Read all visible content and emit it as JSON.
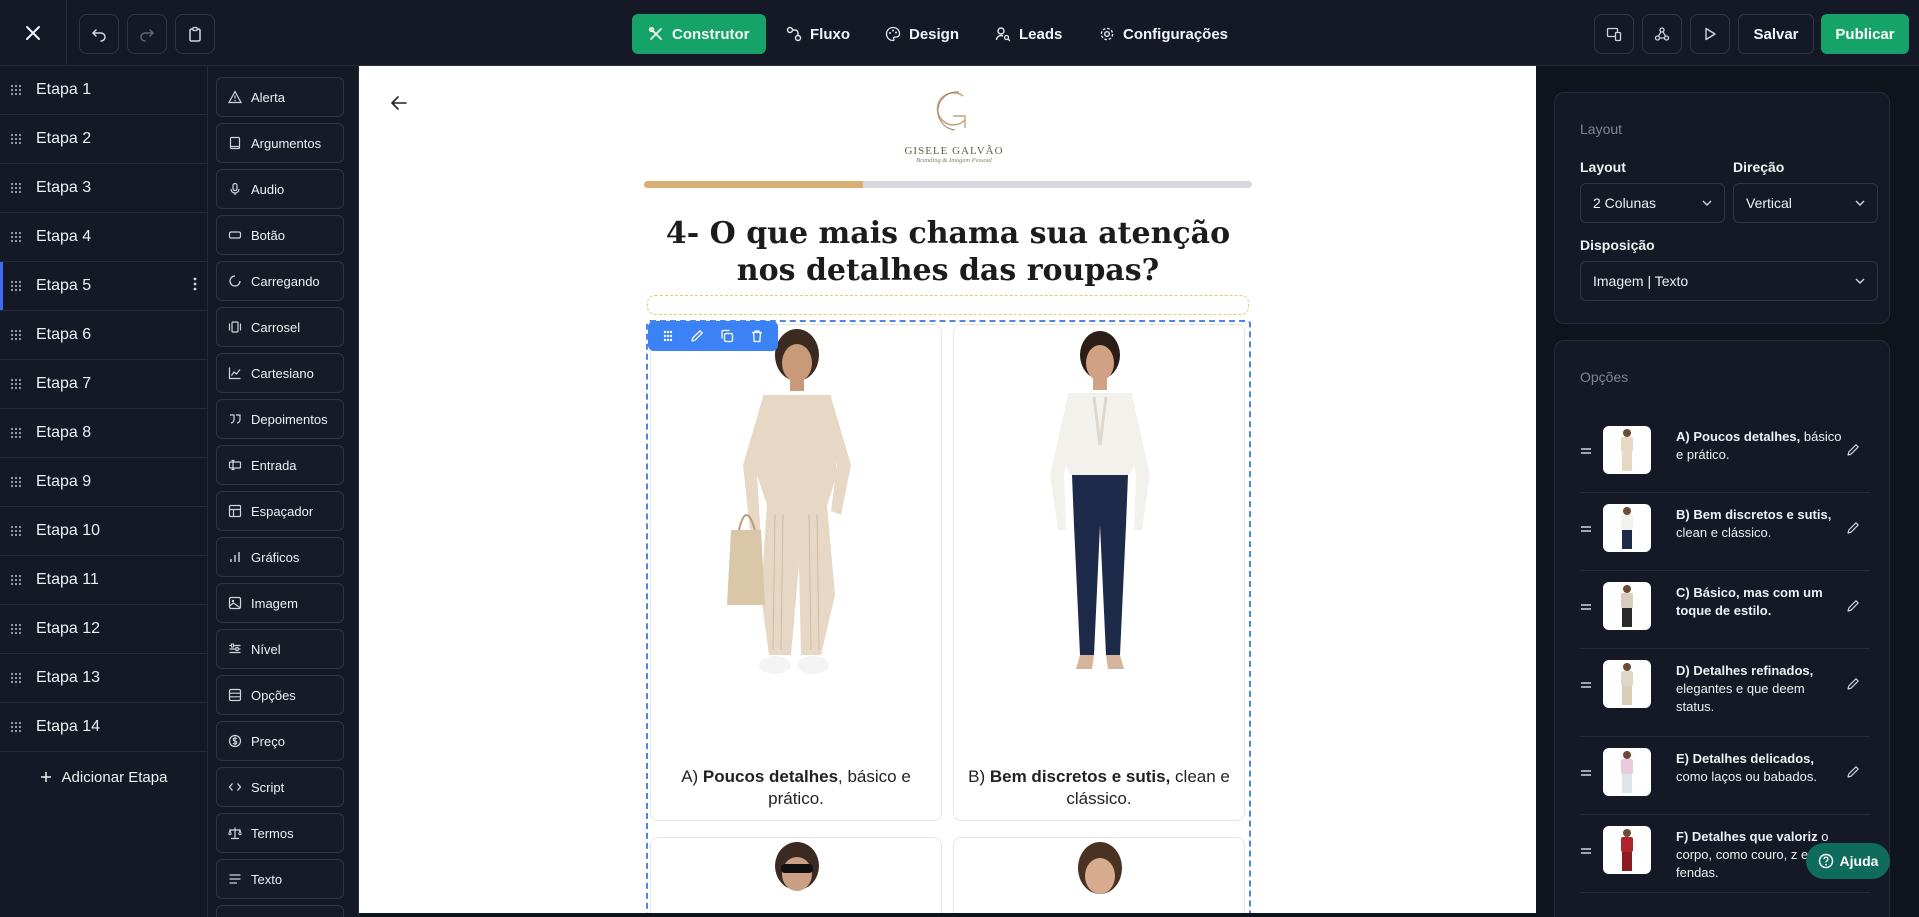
{
  "topbar": {
    "nav": [
      {
        "label": "Construtor",
        "icon": "tools-icon",
        "active": true
      },
      {
        "label": "Fluxo",
        "icon": "flow-icon"
      },
      {
        "label": "Design",
        "icon": "palette-icon"
      },
      {
        "label": "Leads",
        "icon": "user-search-icon"
      },
      {
        "label": "Configurações",
        "icon": "gear-icon"
      }
    ],
    "save_label": "Salvar",
    "publish_label": "Publicar",
    "accent_color": "#16a36a"
  },
  "steps": {
    "items": [
      {
        "label": "Etapa 1"
      },
      {
        "label": "Etapa 2"
      },
      {
        "label": "Etapa 3"
      },
      {
        "label": "Etapa 4"
      },
      {
        "label": "Etapa 5",
        "active": true
      },
      {
        "label": "Etapa 6"
      },
      {
        "label": "Etapa 7"
      },
      {
        "label": "Etapa 8"
      },
      {
        "label": "Etapa 9"
      },
      {
        "label": "Etapa 10"
      },
      {
        "label": "Etapa 11"
      },
      {
        "label": "Etapa 12"
      },
      {
        "label": "Etapa 13"
      },
      {
        "label": "Etapa 14"
      }
    ],
    "add_label": "Adicionar Etapa"
  },
  "components": [
    {
      "label": "Alerta",
      "icon": "alert-triangle-icon"
    },
    {
      "label": "Argumentos",
      "icon": "book-icon"
    },
    {
      "label": "Audio",
      "icon": "mic-icon"
    },
    {
      "label": "Botão",
      "icon": "button-icon"
    },
    {
      "label": "Carregando",
      "icon": "loader-icon"
    },
    {
      "label": "Carrosel",
      "icon": "carousel-icon"
    },
    {
      "label": "Cartesiano",
      "icon": "chart-line-icon"
    },
    {
      "label": "Depoimentos",
      "icon": "quote-icon"
    },
    {
      "label": "Entrada",
      "icon": "text-cursor-icon"
    },
    {
      "label": "Espaçador",
      "icon": "spacer-icon"
    },
    {
      "label": "Gráficos",
      "icon": "bar-chart-icon"
    },
    {
      "label": "Imagem",
      "icon": "image-icon"
    },
    {
      "label": "Nível",
      "icon": "sliders-icon"
    },
    {
      "label": "Opções",
      "icon": "list-icon"
    },
    {
      "label": "Preço",
      "icon": "dollar-icon"
    },
    {
      "label": "Script",
      "icon": "code-icon"
    },
    {
      "label": "Termos",
      "icon": "scale-icon"
    },
    {
      "label": "Texto",
      "icon": "text-icon"
    }
  ],
  "canvas": {
    "logo": {
      "brand": "GISELE GALVÃO",
      "tagline": "Branding & Imagem Pessoal",
      "monogram": "G"
    },
    "progress": 0.36,
    "question": "4- O que mais chama sua atenção nos detalhes das roupas?",
    "options": [
      {
        "prefix": "A) ",
        "bold": "Poucos detalhes",
        "rest": ", básico e prático."
      },
      {
        "prefix": "B) ",
        "bold": "Bem discretos e sutis,",
        "rest": " clean e clássico."
      }
    ]
  },
  "panel": {
    "layout_card": {
      "title": "Layout",
      "layout_label": "Layout",
      "layout_value": "2 Colunas",
      "direction_label": "Direção",
      "direction_value": "Vertical",
      "arrangement_label": "Disposição",
      "arrangement_value": "Imagem | Texto"
    },
    "options_card": {
      "title": "Opções",
      "items": [
        {
          "bold": "A) Poucos detalhes,",
          "rest": " básico e prático."
        },
        {
          "bold": "B) Bem discretos e sutis,",
          "rest": " clean e clássico."
        },
        {
          "bold": "C) Básico, mas com um toque de estilo.",
          "rest": ""
        },
        {
          "bold": "D) Detalhes refinados,",
          "rest": " elegantes e que deem status."
        },
        {
          "bold": "E) Detalhes delicados,",
          "rest": " como laços ou babados."
        },
        {
          "bold": "F) Detalhes que valoriz",
          "rest": " o corpo, como couro, z e fendas."
        }
      ]
    },
    "help_label": "Ajuda"
  }
}
